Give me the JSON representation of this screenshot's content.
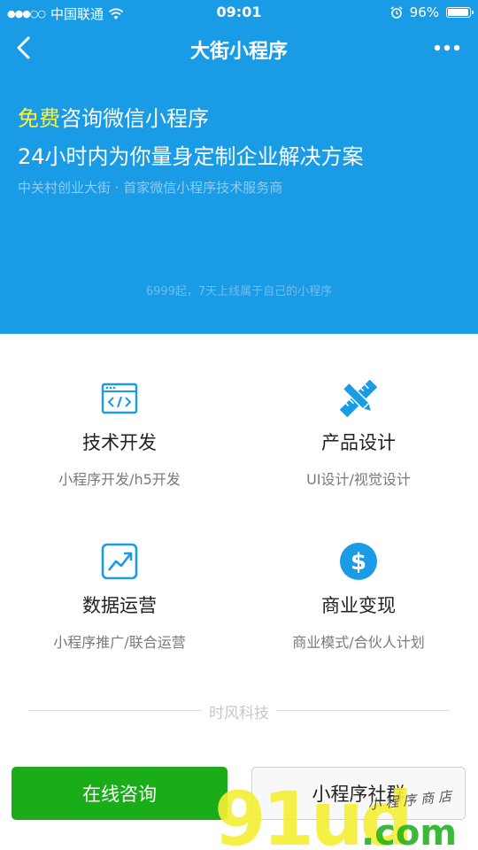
{
  "status": {
    "carrier": "中国联通",
    "time": "09:01",
    "battery_percent": "96%",
    "battery_level": 0.96
  },
  "nav": {
    "title": "大街小程序",
    "back_icon": "chevron-left-icon",
    "more_icon": "more-dots-icon"
  },
  "hero": {
    "free": "免费",
    "line1_rest": "咨询微信小程序",
    "line2": "24小时内为你量身定制企业解决方案",
    "subtitle": "中关村创业大街 · 首家微信小程序技术服务商",
    "note": "6999起，7天上线属于自己的小程序"
  },
  "services": [
    {
      "icon": "code-window-icon",
      "title": "技术开发",
      "desc": "小程序开发/h5开发"
    },
    {
      "icon": "pencil-ruler-icon",
      "title": "产品设计",
      "desc": "UI设计/视觉设计"
    },
    {
      "icon": "trend-chart-icon",
      "title": "数据运营",
      "desc": "小程序推广/联合运营"
    },
    {
      "icon": "dollar-coin-icon",
      "title": "商业变现",
      "desc": "商业模式/合伙人计划"
    }
  ],
  "divider_label": "时风科技",
  "buttons": {
    "consult": "在线咨询",
    "group": "小程序社群"
  },
  "watermark": {
    "brand": "91ud",
    "domain": ".com",
    "caption": "小程序商店"
  },
  "colors": {
    "brand_blue": "#1a9be6",
    "highlight_yellow": "#f8f14e",
    "consult_green": "#1aad19"
  }
}
